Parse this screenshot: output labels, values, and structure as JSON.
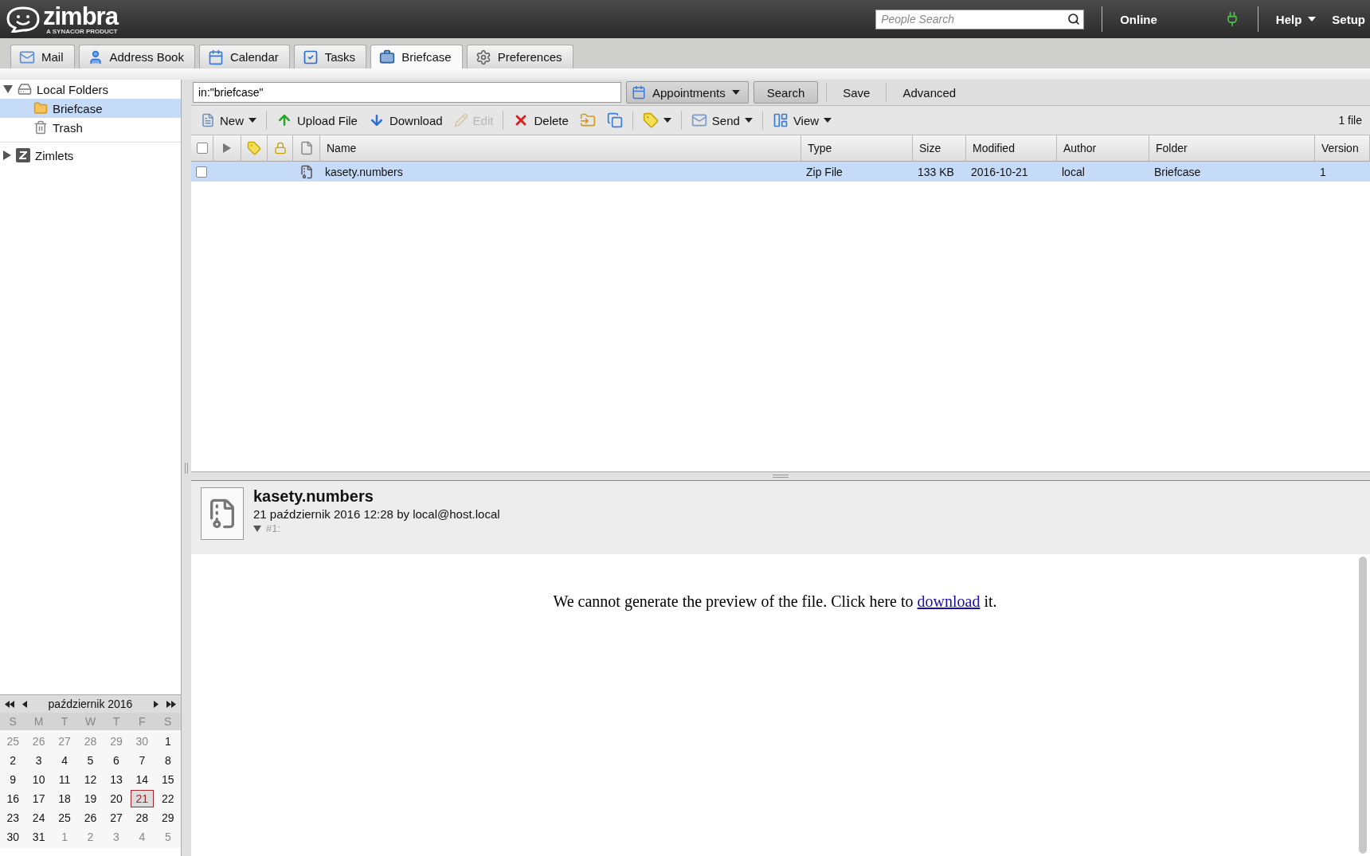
{
  "header": {
    "logo": "zimbra",
    "logo_tagline": "A SYNACOR PRODUCT",
    "people_search": {
      "placeholder": "People Search"
    },
    "status": "Online",
    "help": "Help",
    "setup": "Setup"
  },
  "app_tabs": [
    {
      "kind": "mail",
      "label": "Mail",
      "selected": false
    },
    {
      "kind": "contacts",
      "label": "Address Book",
      "selected": false
    },
    {
      "kind": "calendar",
      "label": "Calendar",
      "selected": false
    },
    {
      "kind": "tasks",
      "label": "Tasks",
      "selected": false
    },
    {
      "kind": "briefcase",
      "label": "Briefcase",
      "selected": true
    },
    {
      "kind": "preferences",
      "label": "Preferences",
      "selected": false
    }
  ],
  "sidebar": {
    "folders": [
      {
        "kind": "root",
        "label": "Local Folders",
        "expanded": true,
        "selected": false,
        "children": [
          {
            "kind": "folder",
            "label": "Briefcase",
            "selected": true
          },
          {
            "kind": "trash",
            "label": "Trash",
            "selected": false
          }
        ]
      }
    ],
    "zimlets": {
      "label": "Zimlets",
      "expanded": false
    }
  },
  "search": {
    "query": "in:\"briefcase\"",
    "type_menu": "Appointments",
    "search_button": "Search",
    "save_button": "Save",
    "advanced_link": "Advanced"
  },
  "toolbar": {
    "items": [
      {
        "kind": "new",
        "label": "New",
        "dropdown": true,
        "disabled": false
      },
      {
        "kind": "upload",
        "label": "Upload File",
        "dropdown": false,
        "disabled": false
      },
      {
        "kind": "download",
        "label": "Download",
        "dropdown": false,
        "disabled": false
      },
      {
        "kind": "edit",
        "label": "Edit",
        "dropdown": false,
        "disabled": true
      },
      {
        "kind": "delete",
        "label": "Delete",
        "dropdown": false,
        "disabled": false
      },
      {
        "kind": "move",
        "dropdown": false,
        "disabled": false
      },
      {
        "kind": "duplicate",
        "dropdown": false,
        "disabled": false
      },
      {
        "kind": "tag",
        "dropdown": true,
        "disabled": false
      },
      {
        "kind": "send",
        "label": "Send",
        "dropdown": true,
        "disabled": false
      },
      {
        "kind": "view",
        "label": "View",
        "dropdown": true,
        "disabled": false
      }
    ],
    "count": "1 file"
  },
  "table": {
    "select_all_checked": false,
    "columns": [
      "Name",
      "Type",
      "Size",
      "Modified",
      "Author",
      "Folder",
      "Version"
    ],
    "rows": [
      {
        "name": "kasety.numbers",
        "type": "Zip File",
        "size": "133 KB",
        "modified": "2016-10-21",
        "author": "local",
        "folder": "Briefcase",
        "version": "1",
        "selected": true,
        "checked": false
      }
    ]
  },
  "preview": {
    "title": "kasety.numbers",
    "meta": "21 październik 2016 12:28 by local@host.local",
    "version_label": "#1:",
    "version_expanded": true,
    "message": "We cannot generate the preview of the file. Click here to",
    "link": "download",
    "message_end": "it."
  },
  "calendar": {
    "month": "październik 2016",
    "weekdays": [
      "S",
      "M",
      "T",
      "W",
      "T",
      "F",
      "S"
    ],
    "weeks": [
      [
        {
          "label": "25",
          "outside": true,
          "today": false
        },
        {
          "label": "26",
          "outside": true,
          "today": false
        },
        {
          "label": "27",
          "outside": true,
          "today": false
        },
        {
          "label": "28",
          "outside": true,
          "today": false
        },
        {
          "label": "29",
          "outside": true,
          "today": false
        },
        {
          "label": "30",
          "outside": true,
          "today": false
        },
        {
          "label": "1",
          "outside": false,
          "today": false
        }
      ],
      [
        {
          "label": "2",
          "outside": false,
          "today": false
        },
        {
          "label": "3",
          "outside": false,
          "today": false
        },
        {
          "label": "4",
          "outside": false,
          "today": false
        },
        {
          "label": "5",
          "outside": false,
          "today": false
        },
        {
          "label": "6",
          "outside": false,
          "today": false
        },
        {
          "label": "7",
          "outside": false,
          "today": false
        },
        {
          "label": "8",
          "outside": false,
          "today": false
        }
      ],
      [
        {
          "label": "9",
          "outside": false,
          "today": false
        },
        {
          "label": "10",
          "outside": false,
          "today": false
        },
        {
          "label": "11",
          "outside": false,
          "today": false
        },
        {
          "label": "12",
          "outside": false,
          "today": false
        },
        {
          "label": "13",
          "outside": false,
          "today": false
        },
        {
          "label": "14",
          "outside": false,
          "today": false
        },
        {
          "label": "15",
          "outside": false,
          "today": false
        }
      ],
      [
        {
          "label": "16",
          "outside": false,
          "today": false
        },
        {
          "label": "17",
          "outside": false,
          "today": false
        },
        {
          "label": "18",
          "outside": false,
          "today": false
        },
        {
          "label": "19",
          "outside": false,
          "today": false
        },
        {
          "label": "20",
          "outside": false,
          "today": false
        },
        {
          "label": "21",
          "outside": false,
          "today": true
        },
        {
          "label": "22",
          "outside": false,
          "today": false
        }
      ],
      [
        {
          "label": "23",
          "outside": false,
          "today": false
        },
        {
          "label": "24",
          "outside": false,
          "today": false
        },
        {
          "label": "25",
          "outside": false,
          "today": false
        },
        {
          "label": "26",
          "outside": false,
          "today": false
        },
        {
          "label": "27",
          "outside": false,
          "today": false
        },
        {
          "label": "28",
          "outside": false,
          "today": false
        },
        {
          "label": "29",
          "outside": false,
          "today": false
        }
      ],
      [
        {
          "label": "30",
          "outside": false,
          "today": false
        },
        {
          "label": "31",
          "outside": false,
          "today": false
        },
        {
          "label": "1",
          "outside": true,
          "today": false
        },
        {
          "label": "2",
          "outside": true,
          "today": false
        },
        {
          "label": "3",
          "outside": true,
          "today": false
        },
        {
          "label": "4",
          "outside": true,
          "today": false
        },
        {
          "label": "5",
          "outside": true,
          "today": false
        }
      ]
    ]
  }
}
